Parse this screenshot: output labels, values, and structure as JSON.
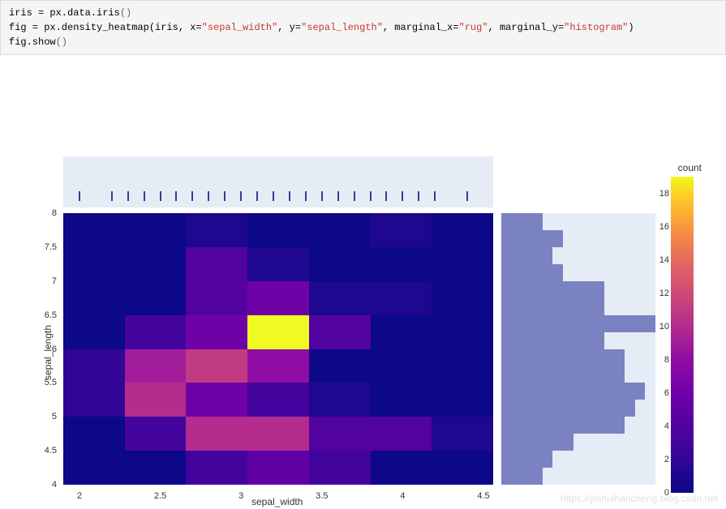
{
  "code": {
    "line1_a": "iris = px.data.iris",
    "line1_b": "()",
    "line2_a": "fig = px.density_heatmap(iris, x=",
    "line2_b": "\"sepal_width\"",
    "line2_c": ", y=",
    "line2_d": "\"sepal_length\"",
    "line2_e": ", marginal_x=",
    "line2_f": "\"rug\"",
    "line2_g": ", marginal_y=",
    "line2_h": "\"histogram\"",
    "line2_i": ")",
    "line3_a": "fig.show",
    "line3_b": "()"
  },
  "axis": {
    "xlabel": "sepal_width",
    "ylabel": "sepal_length"
  },
  "yticks": [
    "8",
    "7.5",
    "7",
    "6.5",
    "6",
    "5.5",
    "5",
    "4.5",
    "4"
  ],
  "xticks": [
    "2",
    "2.5",
    "3",
    "3.5",
    "4",
    "4.5"
  ],
  "colorbar": {
    "title": "count",
    "ticks": [
      "18",
      "16",
      "14",
      "12",
      "10",
      "8",
      "6",
      "4",
      "2",
      "0"
    ]
  },
  "watermark": "https://yishuihancheng.blog.csdn.net",
  "chart_data": {
    "type": "heatmap",
    "xlabel": "sepal_width",
    "ylabel": "sepal_length",
    "x_bins": [
      1.9,
      2.28,
      2.66,
      3.04,
      3.42,
      3.8,
      4.18,
      4.56
    ],
    "y_bins": [
      4.0,
      4.5,
      5.0,
      5.5,
      6.0,
      6.5,
      7.0,
      7.5,
      8.0
    ],
    "counts": [
      [
        0,
        0,
        3,
        5,
        3,
        0,
        0
      ],
      [
        0,
        3,
        10,
        10,
        4,
        4,
        1
      ],
      [
        2,
        10,
        6,
        3,
        1,
        0,
        0
      ],
      [
        2,
        9,
        11,
        8,
        0,
        0,
        0
      ],
      [
        0,
        3,
        6,
        19,
        4,
        0,
        0
      ],
      [
        0,
        0,
        4,
        6,
        1,
        1,
        0
      ],
      [
        0,
        0,
        4,
        1,
        0,
        0,
        0
      ],
      [
        0,
        0,
        1,
        0,
        0,
        1,
        0
      ]
    ],
    "colorscale": "viridis",
    "colorbar_title": "count",
    "color_range": [
      0,
      19
    ],
    "marginal_x": {
      "type": "rug"
    },
    "marginal_y": {
      "type": "histogram",
      "bin_edges": [
        4.0,
        4.25,
        4.5,
        4.75,
        5.0,
        5.25,
        5.5,
        5.75,
        6.0,
        6.25,
        6.5,
        6.75,
        7.0,
        7.25,
        7.5,
        7.75,
        8.0
      ],
      "counts": [
        4,
        5,
        7,
        12,
        13,
        14,
        12,
        12,
        10,
        15,
        10,
        10,
        6,
        5,
        6,
        4
      ]
    }
  }
}
